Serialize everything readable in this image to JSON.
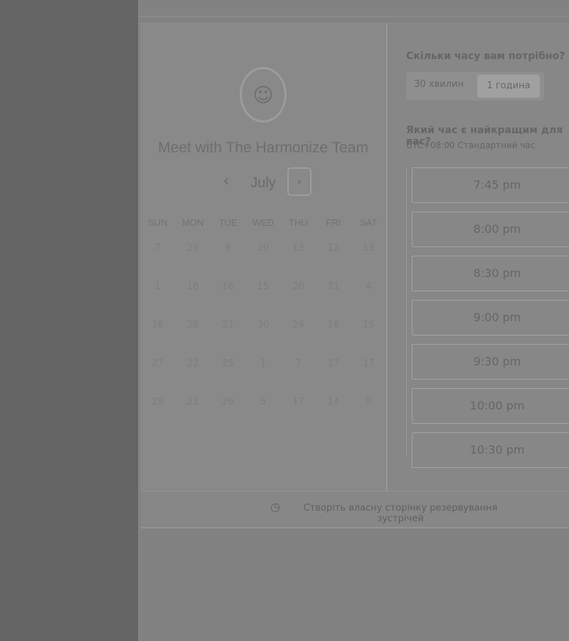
{
  "window": {
    "title": "Meet with The Harmonize Team"
  },
  "calendar": {
    "month": "July",
    "prev_label": "‹",
    "next_label": "›",
    "weekdays": [
      "SUN",
      "MON",
      "TUE",
      "WED",
      "THU",
      "FRI",
      "SAT"
    ],
    "days": [
      [
        "7",
        "25",
        "8",
        "20",
        "13",
        "12",
        "13"
      ],
      [
        "1",
        "16",
        "16",
        "15",
        "20",
        "21",
        "4"
      ],
      [
        "16",
        "26",
        "21",
        "30",
        "24",
        "16",
        "15"
      ],
      [
        "27",
        "22",
        "25",
        "1",
        "7",
        "17",
        "17"
      ],
      [
        "28",
        "22",
        "26",
        "5",
        "17",
        "14",
        "9"
      ]
    ]
  },
  "booking": {
    "duration_heading": "Скільки часу вам потрібно?",
    "duration_options": [
      "30 хвилин",
      "1 година"
    ],
    "time_heading": "Який час є найкращим для вас?",
    "timezone_text": "UTC+08:00 Стандартний час",
    "slots": [
      "7:45 pm",
      "8:00 pm",
      "8:30 pm",
      "9:00 pm",
      "9:30 pm",
      "10:00 pm",
      "10:30 pm"
    ]
  },
  "footer": {
    "link_text": "Створіть власну сторінку резервування зустрічей"
  },
  "colors": {
    "page_bg": "#828282",
    "left_strip": "#646464",
    "panel": "#898989"
  },
  "icons": {
    "avatar": "profile-avatar",
    "footer": "calendar-icon"
  }
}
